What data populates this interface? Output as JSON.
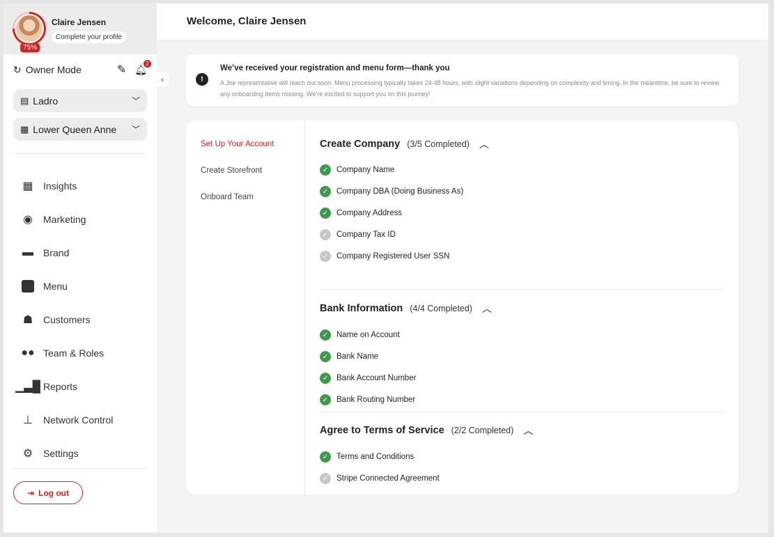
{
  "profile": {
    "name": "Claire Jensen",
    "cta": "Complete your profile",
    "completion": "75%"
  },
  "mode": {
    "label": "Owner Mode",
    "notification_count": "2"
  },
  "selectors": {
    "company": "Ladro",
    "location": "Lower Queen Anne"
  },
  "nav": [
    {
      "label": "Insights",
      "icon": "insights-icon"
    },
    {
      "label": "Marketing",
      "icon": "marketing-icon"
    },
    {
      "label": "Brand",
      "icon": "brand-icon"
    },
    {
      "label": "Menu",
      "icon": "menu-icon"
    },
    {
      "label": "Customers",
      "icon": "customers-icon"
    },
    {
      "label": "Team & Roles",
      "icon": "team-icon"
    },
    {
      "label": "Reports",
      "icon": "reports-icon"
    },
    {
      "label": "Network Control",
      "icon": "network-icon"
    },
    {
      "label": "Settings",
      "icon": "settings-icon"
    }
  ],
  "logout_label": "Log out",
  "header": {
    "title": "Welcome, Claire Jensen"
  },
  "notice": {
    "title": "We’ve received your registration and menu form—thank you",
    "body": "A Joe representative will reach out soon. Menu processing typically takes 24-48 hours, with slight variations depending on complexity and timing. In the meantime, be sure to review any onboarding items missing. We’re excited to support you on this journey!"
  },
  "steps": [
    {
      "label": "Set Up Your Account",
      "active": true
    },
    {
      "label": "Create Storefront",
      "active": false
    },
    {
      "label": "Onboard Team",
      "active": false
    }
  ],
  "sections": [
    {
      "name": "Create Company",
      "progress": "(3/5 Completed)",
      "items": [
        {
          "label": "Company Name",
          "done": true
        },
        {
          "label": "Company DBA (Doing Business As)",
          "done": true
        },
        {
          "label": "Company Address",
          "done": true
        },
        {
          "label": "Company Tax ID",
          "done": false
        },
        {
          "label": "Company Registered User SSN",
          "done": false
        }
      ]
    },
    {
      "name": "Bank Information",
      "progress": "(4/4 Completed)",
      "items": [
        {
          "label": "Name on Account",
          "done": true
        },
        {
          "label": "Bank Name",
          "done": true
        },
        {
          "label": "Bank Account Number",
          "done": true
        },
        {
          "label": "Bank Routing Number",
          "done": true
        }
      ]
    },
    {
      "name": "Agree to Terms of Service",
      "progress": "(2/2 Completed)",
      "items": [
        {
          "label": "Terms and Conditions",
          "done": true
        },
        {
          "label": "Stripe Connected Agreement",
          "done": false
        }
      ]
    }
  ],
  "colors": {
    "accent": "#d9201f",
    "done": "#3e9a4a",
    "todo": "#c7c7c7"
  }
}
